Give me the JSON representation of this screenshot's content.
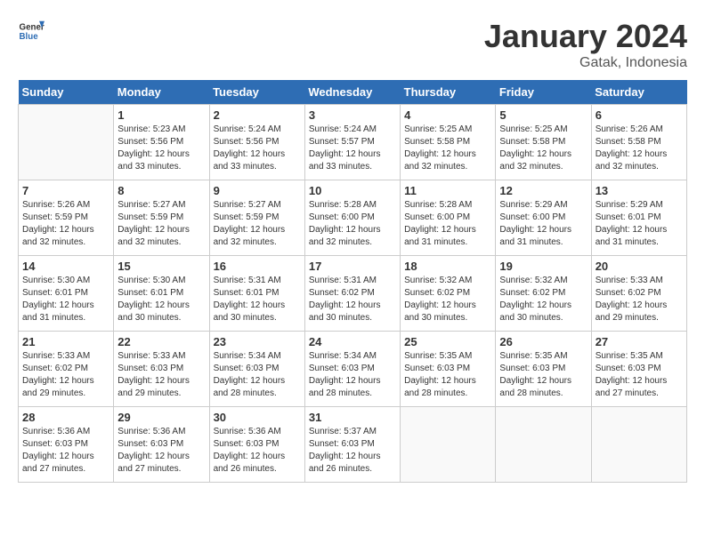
{
  "header": {
    "logo_line1": "General",
    "logo_line2": "Blue",
    "title": "January 2024",
    "subtitle": "Gatak, Indonesia"
  },
  "weekdays": [
    "Sunday",
    "Monday",
    "Tuesday",
    "Wednesday",
    "Thursday",
    "Friday",
    "Saturday"
  ],
  "weeks": [
    [
      {
        "day": "",
        "info": ""
      },
      {
        "day": "1",
        "info": "Sunrise: 5:23 AM\nSunset: 5:56 PM\nDaylight: 12 hours\nand 33 minutes."
      },
      {
        "day": "2",
        "info": "Sunrise: 5:24 AM\nSunset: 5:56 PM\nDaylight: 12 hours\nand 33 minutes."
      },
      {
        "day": "3",
        "info": "Sunrise: 5:24 AM\nSunset: 5:57 PM\nDaylight: 12 hours\nand 33 minutes."
      },
      {
        "day": "4",
        "info": "Sunrise: 5:25 AM\nSunset: 5:58 PM\nDaylight: 12 hours\nand 32 minutes."
      },
      {
        "day": "5",
        "info": "Sunrise: 5:25 AM\nSunset: 5:58 PM\nDaylight: 12 hours\nand 32 minutes."
      },
      {
        "day": "6",
        "info": "Sunrise: 5:26 AM\nSunset: 5:58 PM\nDaylight: 12 hours\nand 32 minutes."
      }
    ],
    [
      {
        "day": "7",
        "info": "Sunrise: 5:26 AM\nSunset: 5:59 PM\nDaylight: 12 hours\nand 32 minutes."
      },
      {
        "day": "8",
        "info": "Sunrise: 5:27 AM\nSunset: 5:59 PM\nDaylight: 12 hours\nand 32 minutes."
      },
      {
        "day": "9",
        "info": "Sunrise: 5:27 AM\nSunset: 5:59 PM\nDaylight: 12 hours\nand 32 minutes."
      },
      {
        "day": "10",
        "info": "Sunrise: 5:28 AM\nSunset: 6:00 PM\nDaylight: 12 hours\nand 32 minutes."
      },
      {
        "day": "11",
        "info": "Sunrise: 5:28 AM\nSunset: 6:00 PM\nDaylight: 12 hours\nand 31 minutes."
      },
      {
        "day": "12",
        "info": "Sunrise: 5:29 AM\nSunset: 6:00 PM\nDaylight: 12 hours\nand 31 minutes."
      },
      {
        "day": "13",
        "info": "Sunrise: 5:29 AM\nSunset: 6:01 PM\nDaylight: 12 hours\nand 31 minutes."
      }
    ],
    [
      {
        "day": "14",
        "info": "Sunrise: 5:30 AM\nSunset: 6:01 PM\nDaylight: 12 hours\nand 31 minutes."
      },
      {
        "day": "15",
        "info": "Sunrise: 5:30 AM\nSunset: 6:01 PM\nDaylight: 12 hours\nand 30 minutes."
      },
      {
        "day": "16",
        "info": "Sunrise: 5:31 AM\nSunset: 6:01 PM\nDaylight: 12 hours\nand 30 minutes."
      },
      {
        "day": "17",
        "info": "Sunrise: 5:31 AM\nSunset: 6:02 PM\nDaylight: 12 hours\nand 30 minutes."
      },
      {
        "day": "18",
        "info": "Sunrise: 5:32 AM\nSunset: 6:02 PM\nDaylight: 12 hours\nand 30 minutes."
      },
      {
        "day": "19",
        "info": "Sunrise: 5:32 AM\nSunset: 6:02 PM\nDaylight: 12 hours\nand 30 minutes."
      },
      {
        "day": "20",
        "info": "Sunrise: 5:33 AM\nSunset: 6:02 PM\nDaylight: 12 hours\nand 29 minutes."
      }
    ],
    [
      {
        "day": "21",
        "info": "Sunrise: 5:33 AM\nSunset: 6:02 PM\nDaylight: 12 hours\nand 29 minutes."
      },
      {
        "day": "22",
        "info": "Sunrise: 5:33 AM\nSunset: 6:03 PM\nDaylight: 12 hours\nand 29 minutes."
      },
      {
        "day": "23",
        "info": "Sunrise: 5:34 AM\nSunset: 6:03 PM\nDaylight: 12 hours\nand 28 minutes."
      },
      {
        "day": "24",
        "info": "Sunrise: 5:34 AM\nSunset: 6:03 PM\nDaylight: 12 hours\nand 28 minutes."
      },
      {
        "day": "25",
        "info": "Sunrise: 5:35 AM\nSunset: 6:03 PM\nDaylight: 12 hours\nand 28 minutes."
      },
      {
        "day": "26",
        "info": "Sunrise: 5:35 AM\nSunset: 6:03 PM\nDaylight: 12 hours\nand 28 minutes."
      },
      {
        "day": "27",
        "info": "Sunrise: 5:35 AM\nSunset: 6:03 PM\nDaylight: 12 hours\nand 27 minutes."
      }
    ],
    [
      {
        "day": "28",
        "info": "Sunrise: 5:36 AM\nSunset: 6:03 PM\nDaylight: 12 hours\nand 27 minutes."
      },
      {
        "day": "29",
        "info": "Sunrise: 5:36 AM\nSunset: 6:03 PM\nDaylight: 12 hours\nand 27 minutes."
      },
      {
        "day": "30",
        "info": "Sunrise: 5:36 AM\nSunset: 6:03 PM\nDaylight: 12 hours\nand 26 minutes."
      },
      {
        "day": "31",
        "info": "Sunrise: 5:37 AM\nSunset: 6:03 PM\nDaylight: 12 hours\nand 26 minutes."
      },
      {
        "day": "",
        "info": ""
      },
      {
        "day": "",
        "info": ""
      },
      {
        "day": "",
        "info": ""
      }
    ]
  ]
}
